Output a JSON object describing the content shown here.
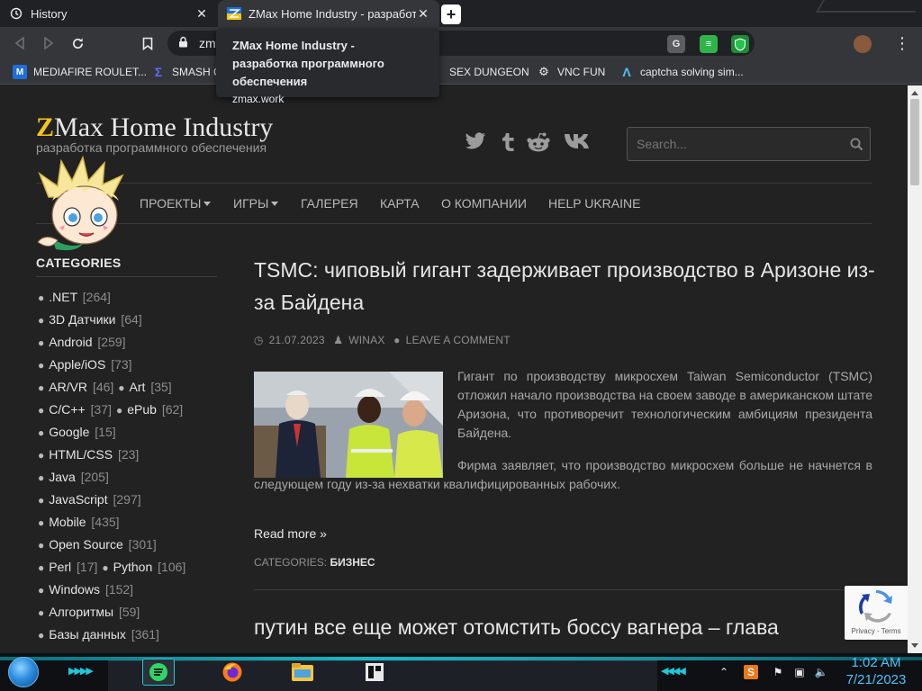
{
  "tabs": [
    {
      "title": "History",
      "icon": "history-icon"
    },
    {
      "title": "ZMax Home Industry - разработка п",
      "icon": "zmax-favicon"
    }
  ],
  "tooltip": {
    "title": "ZMax Home Industry - разработка программного обеспечения",
    "url": "zmax.work"
  },
  "omnibox": {
    "text": "zma"
  },
  "bookmarks": [
    {
      "label": "MEDIAFIRE ROULET...",
      "icon": "mediafire-icon"
    },
    {
      "label": "SMASH C",
      "icon": "smash-icon"
    },
    {
      "label": "SEX DUNGEON",
      "icon": "bookmark-icon"
    },
    {
      "label": "VNC FUN",
      "icon": "vnc-icon"
    },
    {
      "label": "captcha solving sim...",
      "icon": "captcha-icon"
    }
  ],
  "site": {
    "title_z": "Z",
    "title_rest": "Max Home Industry",
    "subtitle": "разработка программного обеспечения",
    "search_placeholder": "Search..."
  },
  "nav": [
    {
      "label": "ПРОЕКТЫ",
      "dropdown": true
    },
    {
      "label": "ИГРЫ",
      "dropdown": true
    },
    {
      "label": "ГАЛЕРЕЯ",
      "dropdown": false
    },
    {
      "label": "КАРТА",
      "dropdown": false
    },
    {
      "label": "О КОМПАНИИ",
      "dropdown": false
    },
    {
      "label": "HELP UKRAINE",
      "dropdown": false
    }
  ],
  "categories": {
    "heading": "CATEGORIES",
    "rows": [
      [
        {
          "name": ".NET",
          "count": "[264]"
        }
      ],
      [
        {
          "name": "3D Датчики",
          "count": "[64]"
        }
      ],
      [
        {
          "name": "Android",
          "count": "[259]"
        }
      ],
      [
        {
          "name": "Apple/iOS",
          "count": "[73]"
        }
      ],
      [
        {
          "name": "AR/VR",
          "count": "[46]"
        },
        {
          "name": "Art",
          "count": "[35]"
        }
      ],
      [
        {
          "name": "C/C++",
          "count": "[37]"
        },
        {
          "name": "ePub",
          "count": "[62]"
        }
      ],
      [
        {
          "name": "Google",
          "count": "[15]"
        }
      ],
      [
        {
          "name": "HTML/CSS",
          "count": "[23]"
        }
      ],
      [
        {
          "name": "Java",
          "count": "[205]"
        }
      ],
      [
        {
          "name": "JavaScript",
          "count": "[297]"
        }
      ],
      [
        {
          "name": "Mobile",
          "count": "[435]"
        }
      ],
      [
        {
          "name": "Open Source",
          "count": "[301]"
        }
      ],
      [
        {
          "name": "Perl",
          "count": "[17]"
        },
        {
          "name": "Python",
          "count": "[106]"
        }
      ],
      [
        {
          "name": "Windows",
          "count": "[152]"
        }
      ],
      [
        {
          "name": "Алгоритмы",
          "count": "[59]"
        }
      ],
      [
        {
          "name": "Базы данных",
          "count": "[361]"
        }
      ]
    ]
  },
  "post": {
    "title": "TSMC: чиповый гигант задерживает производство в Аризоне из-за Байдена",
    "date": "21.07.2023",
    "author": "WINAX",
    "comment": "LEAVE A COMMENT",
    "para1": "Гигант по производству микросхем Taiwan Semiconductor (TSMC) отложил начало производства на своем заводе в американском штате Аризона, что противоречит технологическим амбициям президента Байдена.",
    "para2": "Фирма заявляет, что производство микросхем больше не начнется в следующем году из-за нехватки квалифицированных рабочих.",
    "read_more": "Read more",
    "categories_label": "CATEGORIES:",
    "category": "БИЗНЕС"
  },
  "next_post": {
    "title": "путин все еще может отомстить боссу вагнера – глава"
  },
  "recaptcha": {
    "links": "Privacy - Terms"
  },
  "clock": {
    "time": "1:02 AM",
    "date": "7/21/2023"
  },
  "colors": {
    "accent": "#f5c518",
    "taskbar_accent": "#1fc8d8"
  }
}
